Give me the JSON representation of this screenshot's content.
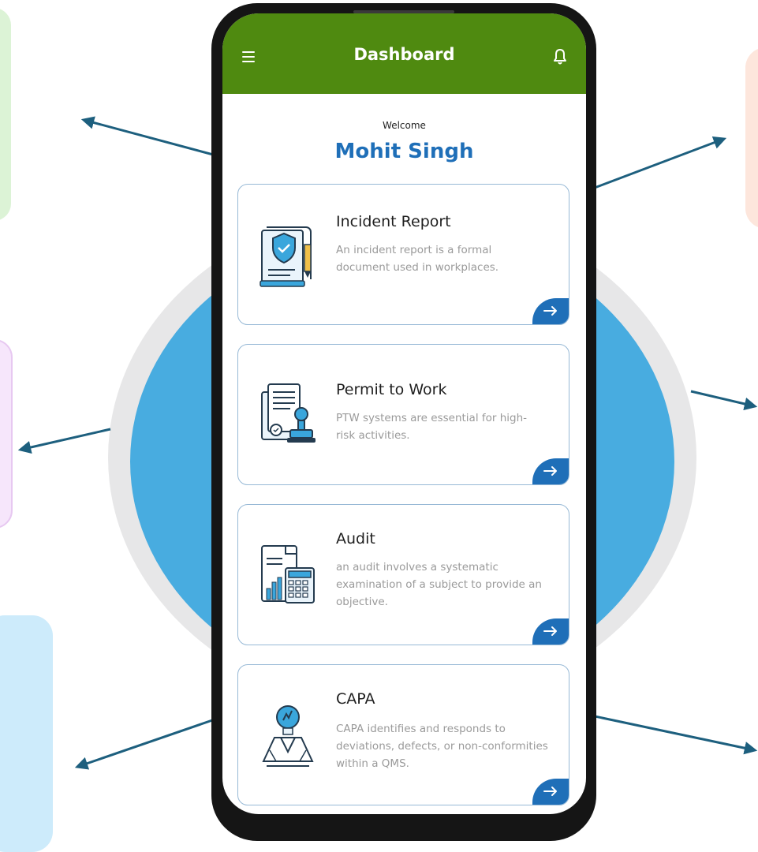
{
  "app": {
    "title": "Dashboard",
    "menu_icon": "hamburger-menu-icon",
    "notification_icon": "bell-icon",
    "header_color": "#4f8a10"
  },
  "greeting": {
    "welcome": "Welcome",
    "user_name": "Mohit Singh"
  },
  "modules": [
    {
      "title": "Incident Report",
      "description": "An incident report is a formal document used in workplaces.",
      "icon": "incident-report-document-icon",
      "action_icon": "arrow-right-icon"
    },
    {
      "title": "Permit to Work",
      "description": "PTW systems are essential for high-risk activities.",
      "icon": "permit-stamp-icon",
      "action_icon": "arrow-right-icon"
    },
    {
      "title": "Audit",
      "description": "an audit involves a systematic examination of a subject to provide an objective.",
      "icon": "audit-calculator-icon",
      "action_icon": "arrow-right-icon"
    },
    {
      "title": "CAPA",
      "description": "CAPA identifies and responds to deviations, defects, or non-conformities within a QMS.",
      "icon": "capa-lightbulb-person-icon",
      "action_icon": "arrow-right-icon"
    }
  ],
  "colors": {
    "accent": "#1f6fb8",
    "card_border": "#97b9d6",
    "background_circle": "#48ace0",
    "arrow_color": "#1d5f7e"
  }
}
